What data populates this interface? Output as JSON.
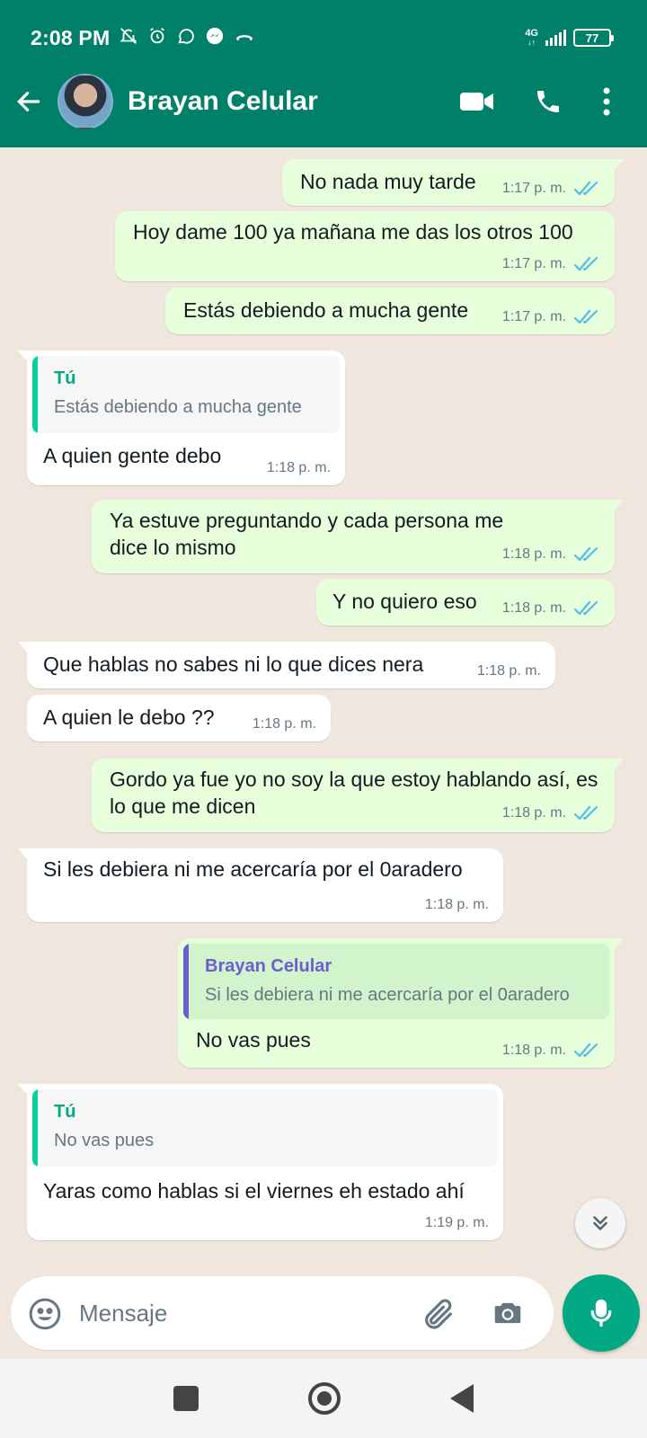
{
  "status_bar": {
    "time": "2:08 PM",
    "network": "4G",
    "battery": "77"
  },
  "header": {
    "contact_name": "Brayan Celular"
  },
  "colors": {
    "header": "#008069",
    "outgoing_bubble": "#e7ffdb",
    "incoming_bubble": "#ffffff",
    "read_ticks": "#53bdeb",
    "accent": "#00a884",
    "quote_you": "#06cf9c",
    "quote_contact": "#6b5fd0"
  },
  "messages": [
    {
      "direction": "out",
      "text": "No nada muy tarde",
      "time": "1:17 p. m.",
      "read": true
    },
    {
      "direction": "out",
      "text": "Hoy dame 100 ya mañana me das los otros 100",
      "time": "1:17 p. m.",
      "read": true
    },
    {
      "direction": "out",
      "text": "Estás debiendo a mucha gente",
      "time": "1:17 p. m.",
      "read": true
    },
    {
      "direction": "in",
      "quote": {
        "author": "Tú",
        "text": "Estás debiendo a mucha gente"
      },
      "text": "A quien gente debo",
      "time": "1:18 p. m."
    },
    {
      "direction": "out",
      "text": "Ya estuve preguntando y cada persona me dice lo mismo",
      "time": "1:18 p. m.",
      "read": true
    },
    {
      "direction": "out",
      "text": "Y no quiero eso",
      "time": "1:18 p. m.",
      "read": true
    },
    {
      "direction": "in",
      "text": "Que hablas no sabes ni lo que dices nera",
      "time": "1:18 p. m."
    },
    {
      "direction": "in",
      "text": "A quien le debo ??",
      "time": "1:18 p. m."
    },
    {
      "direction": "out",
      "text": "Gordo ya fue yo no soy la que estoy hablando así, es lo que me dicen",
      "time": "1:18 p. m.",
      "read": true
    },
    {
      "direction": "in",
      "text": "Si les debiera ni me acercaría por el 0aradero",
      "time": "1:18 p. m."
    },
    {
      "direction": "out",
      "quote": {
        "author": "Brayan Celular",
        "text": "Si les debiera ni me acercaría por el 0aradero"
      },
      "text": "No vas pues",
      "time": "1:18 p. m.",
      "read": true
    },
    {
      "direction": "in",
      "quote": {
        "author": "Tú",
        "text": "No vas pues"
      },
      "text": "Yaras como hablas si el viernes eh estado ahí",
      "time": "1:19 p. m."
    }
  ],
  "composer": {
    "placeholder": "Mensaje"
  },
  "icons": [
    "back-arrow-icon",
    "video-call-icon",
    "phone-icon",
    "more-options-icon",
    "emoji-icon",
    "attach-icon",
    "camera-icon",
    "mic-icon",
    "chevron-down-icon",
    "double-check-icon"
  ]
}
